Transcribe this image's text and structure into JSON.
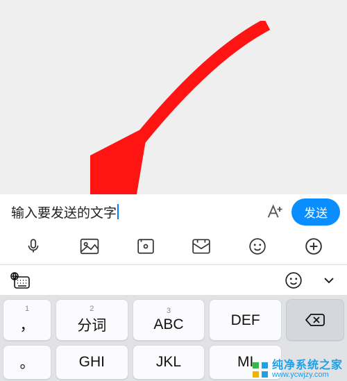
{
  "input": {
    "text": "输入要发送的文字"
  },
  "buttons": {
    "send": "发送"
  },
  "icons": {
    "font_adjust": "font-adjust-icon",
    "mic": "microphone-icon",
    "gallery": "gallery-icon",
    "camera": "camera-icon",
    "envelope": "envelope-icon",
    "smile": "smile-icon",
    "plus": "plus-icon",
    "globe_kb": "globe-keyboard-icon",
    "kb_smile": "keyboard-smile-icon",
    "kb_chevron": "chevron-down-icon",
    "backspace": "backspace-icon"
  },
  "keyboard": {
    "row1": [
      {
        "sup": "1",
        "label": "，"
      },
      {
        "sup": "2",
        "label": "分词"
      },
      {
        "sup": "3",
        "label": "ABC"
      },
      {
        "sup": "",
        "label": "DEF"
      }
    ],
    "row2": [
      {
        "label": "GHI"
      },
      {
        "label": "JKL"
      },
      {
        "label": "MI"
      }
    ]
  },
  "watermark": {
    "title": "纯净系统之家",
    "url": "www.ycwjzy.com"
  }
}
